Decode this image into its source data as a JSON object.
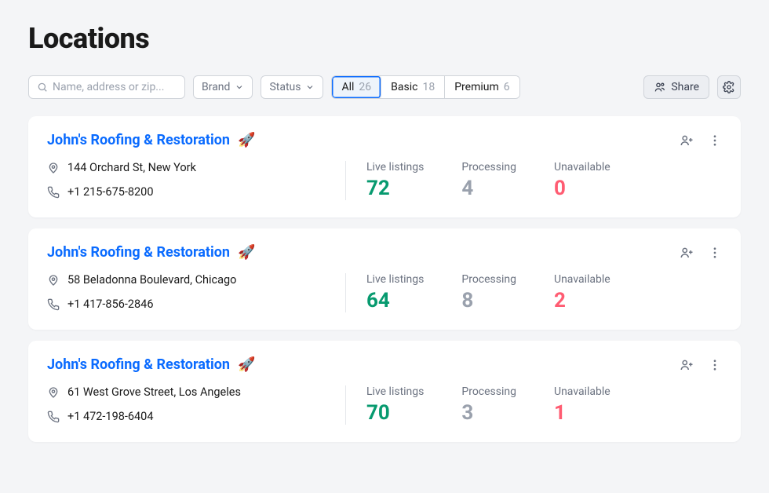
{
  "page_title": "Locations",
  "search": {
    "placeholder": "Name, address or zip..."
  },
  "filters": {
    "brand_label": "Brand",
    "status_label": "Status"
  },
  "tabs": [
    {
      "label": "All",
      "count": "26",
      "active": true
    },
    {
      "label": "Basic",
      "count": "18",
      "active": false
    },
    {
      "label": "Premium",
      "count": "6",
      "active": false
    }
  ],
  "share_label": "Share",
  "stat_labels": {
    "live": "Live listings",
    "processing": "Processing",
    "unavailable": "Unavailable"
  },
  "locations": [
    {
      "name": "John's Roofing & Restoration",
      "address": "144 Orchard St, New York",
      "phone": "+1 215-675-8200",
      "live": "72",
      "processing": "4",
      "unavailable": "0"
    },
    {
      "name": "John's Roofing & Restoration",
      "address": "58 Beladonna Boulevard, Chicago",
      "phone": "+1 417-856-2846",
      "live": "64",
      "processing": "8",
      "unavailable": "2"
    },
    {
      "name": "John's Roofing & Restoration",
      "address": "61 West Grove Street, Los Angeles",
      "phone": "+1 472-198-6404",
      "live": "70",
      "processing": "3",
      "unavailable": "1"
    }
  ]
}
